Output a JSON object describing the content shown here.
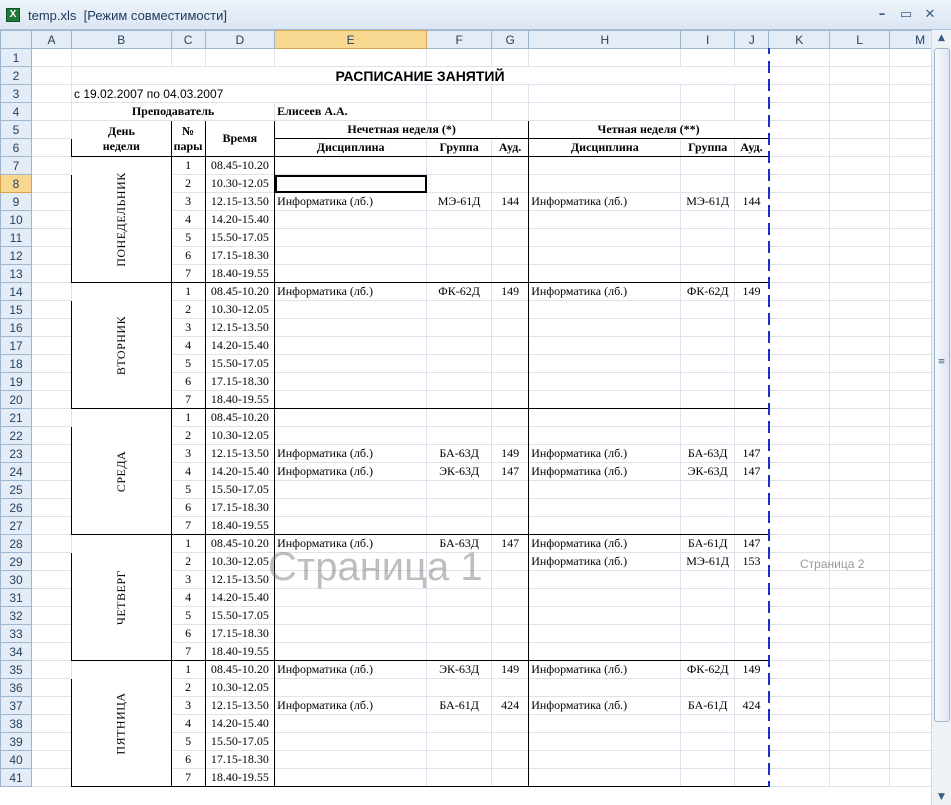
{
  "window": {
    "title": "temp.xls  [Режим совместимости]",
    "app_icon": "excel-icon",
    "min": "–",
    "restore": "▭",
    "close": "✕"
  },
  "columns": [
    "A",
    "B",
    "C",
    "D",
    "E",
    "F",
    "G",
    "H",
    "I",
    "J",
    "K",
    "L",
    "M"
  ],
  "row_numbers": [
    "1",
    "2",
    "3",
    "4",
    "5",
    "6",
    "7",
    "8",
    "9",
    "10",
    "11",
    "12",
    "13",
    "14",
    "15",
    "16",
    "17",
    "18",
    "19",
    "20",
    "21",
    "22",
    "23",
    "24",
    "25",
    "26",
    "27",
    "28",
    "29",
    "30",
    "31",
    "32",
    "33",
    "34",
    "35",
    "36",
    "37",
    "38",
    "39",
    "40",
    "41"
  ],
  "sheet": {
    "title": "РАСПИСАНИЕ ЗАНЯТИЙ",
    "period": "с 19.02.2007 по 04.03.2007",
    "teacher_label": "Преподаватель",
    "teacher_name": "Елисеев А.А.",
    "h_day_1": "День",
    "h_day_2": "недели",
    "h_num_1": "№",
    "h_num_2": "пары",
    "h_time": "Время",
    "h_odd": "Нечетная неделя (*)",
    "h_even": "Четная неделя (**)",
    "h_disc": "Дисциплина",
    "h_group": "Группа",
    "h_room": "Ауд.",
    "days": [
      "ПОНЕДЕЛЬНИК",
      "ВТОРНИК",
      "СРЕДА",
      "ЧЕТВЕРГ",
      "ПЯТНИЦА"
    ],
    "slot_nums": [
      "1",
      "2",
      "3",
      "4",
      "5",
      "6",
      "7"
    ],
    "times": [
      "08.45-10.20",
      "10.30-12.05",
      "12.15-13.50",
      "14.20-15.40",
      "15.50-17.05",
      "17.15-18.30",
      "18.40-19.55"
    ],
    "schedule": [
      [
        [
          "",
          "",
          "",
          "",
          "",
          ""
        ],
        [
          "",
          "",
          "",
          "",
          "",
          ""
        ],
        [
          "Информатика (лб.)",
          "МЭ-61Д",
          "144",
          "Информатика (лб.)",
          "МЭ-61Д",
          "144"
        ],
        [
          "",
          "",
          "",
          "",
          "",
          ""
        ],
        [
          "",
          "",
          "",
          "",
          "",
          ""
        ],
        [
          "",
          "",
          "",
          "",
          "",
          ""
        ],
        [
          "",
          "",
          "",
          "",
          "",
          ""
        ]
      ],
      [
        [
          "Информатика (лб.)",
          "ФК-62Д",
          "149",
          "Информатика (лб.)",
          "ФК-62Д",
          "149"
        ],
        [
          "",
          "",
          "",
          "",
          "",
          ""
        ],
        [
          "",
          "",
          "",
          "",
          "",
          ""
        ],
        [
          "",
          "",
          "",
          "",
          "",
          ""
        ],
        [
          "",
          "",
          "",
          "",
          "",
          ""
        ],
        [
          "",
          "",
          "",
          "",
          "",
          ""
        ],
        [
          "",
          "",
          "",
          "",
          "",
          ""
        ]
      ],
      [
        [
          "",
          "",
          "",
          "",
          "",
          ""
        ],
        [
          "",
          "",
          "",
          "",
          "",
          ""
        ],
        [
          "Информатика (лб.)",
          "БА-63Д",
          "149",
          "Информатика (лб.)",
          "БА-63Д",
          "147"
        ],
        [
          "Информатика (лб.)",
          "ЭК-63Д",
          "147",
          "Информатика (лб.)",
          "ЭК-63Д",
          "147"
        ],
        [
          "",
          "",
          "",
          "",
          "",
          ""
        ],
        [
          "",
          "",
          "",
          "",
          "",
          ""
        ],
        [
          "",
          "",
          "",
          "",
          "",
          ""
        ]
      ],
      [
        [
          "Информатика (лб.)",
          "БА-63Д",
          "147",
          "Информатика (лб.)",
          "БА-61Д",
          "147"
        ],
        [
          "",
          "",
          "",
          "Информатика (лб.)",
          "МЭ-61Д",
          "153"
        ],
        [
          "",
          "",
          "",
          "",
          "",
          ""
        ],
        [
          "",
          "",
          "",
          "",
          "",
          ""
        ],
        [
          "",
          "",
          "",
          "",
          "",
          ""
        ],
        [
          "",
          "",
          "",
          "",
          "",
          ""
        ],
        [
          "",
          "",
          "",
          "",
          "",
          ""
        ]
      ],
      [
        [
          "Информатика (лб.)",
          "ЭК-63Д",
          "149",
          "Информатика (лб.)",
          "ФК-62Д",
          "149"
        ],
        [
          "",
          "",
          "",
          "",
          "",
          ""
        ],
        [
          "Информатика (лб.)",
          "БА-61Д",
          "424",
          "Информатика (лб.)",
          "БА-61Д",
          "424"
        ],
        [
          "",
          "",
          "",
          "",
          "",
          ""
        ],
        [
          "",
          "",
          "",
          "",
          "",
          ""
        ],
        [
          "",
          "",
          "",
          "",
          "",
          ""
        ],
        [
          "",
          "",
          "",
          "",
          "",
          ""
        ]
      ]
    ]
  },
  "watermarks": {
    "page1": "Страница 1",
    "page2": "Страница 2"
  },
  "scrollbar": {
    "up": "▲",
    "down": "▼",
    "grip": "≡"
  },
  "colors": {
    "page_break": "#1a2fc8",
    "header_bg": "#e4ecf7",
    "selected_header": "#f8d890"
  }
}
